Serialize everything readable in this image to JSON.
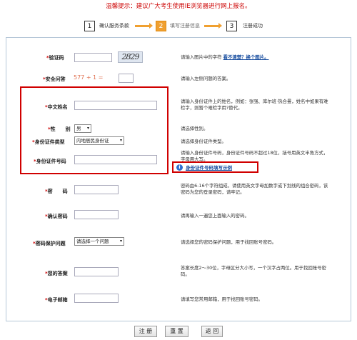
{
  "notice": "温馨提示：建议广大考生使用IE浏览器进行网上报名。",
  "steps": [
    {
      "num": "1",
      "label": "确认服务条款"
    },
    {
      "num": "2",
      "label": "填写注册信息"
    },
    {
      "num": "3",
      "label": "注册成功"
    }
  ],
  "fields": {
    "captcha": {
      "label": "验证码",
      "image_text": "2829",
      "hint": "请输入图片中的字符",
      "hint_link": "看不清楚？换个图片。"
    },
    "security_q": {
      "label": "安全问答",
      "question": "577 + 1 =",
      "hint": "请输入左侧问题的答案。"
    },
    "chinese_name": {
      "label": "中文姓名",
      "hint": "请输入身份证件上的姓名，例如：张强、库尔班·热合曼，姓名中如果有难检字，则暂个难检字用?替代。"
    },
    "gender": {
      "label": "性　　别",
      "value": "男",
      "hint": "请选择性别。"
    },
    "id_type": {
      "label": "身份证件类型",
      "value": "内地居民身份证",
      "hint": "请选择身份证件类型。"
    },
    "id_number": {
      "label": "身份证件号码",
      "hint": "请输入身份证件号码，身份证件号码不超过18位，括号用英文半角方式，字母用大写。",
      "help_link": "身份证件号码填写示例"
    },
    "password": {
      "label": "密　　码",
      "hint": "密码由6-16个字符组成，请使用英文字母加数字或下划线的组合密码，该密码为您的登录密码，请牢记。"
    },
    "confirm_password": {
      "label": "确认密码",
      "hint": "请再输入一遍您上面输入的密码。"
    },
    "pwd_question": {
      "label": "密码保护问题",
      "value": "请选择一个问题",
      "hint": "请选择您的密码保护问题，用于找回账号密码。"
    },
    "answer": {
      "label": "您的答案",
      "hint": "答案长度2～30位，字母区分大小写，一个汉字占两位。用于找回账号密码。"
    },
    "email": {
      "label": "电子邮箱",
      "hint": "请填写您常用邮箱，用于找回账号密码。"
    }
  },
  "buttons": {
    "register": "注 册",
    "reset": "重 置",
    "back": "返 回"
  }
}
